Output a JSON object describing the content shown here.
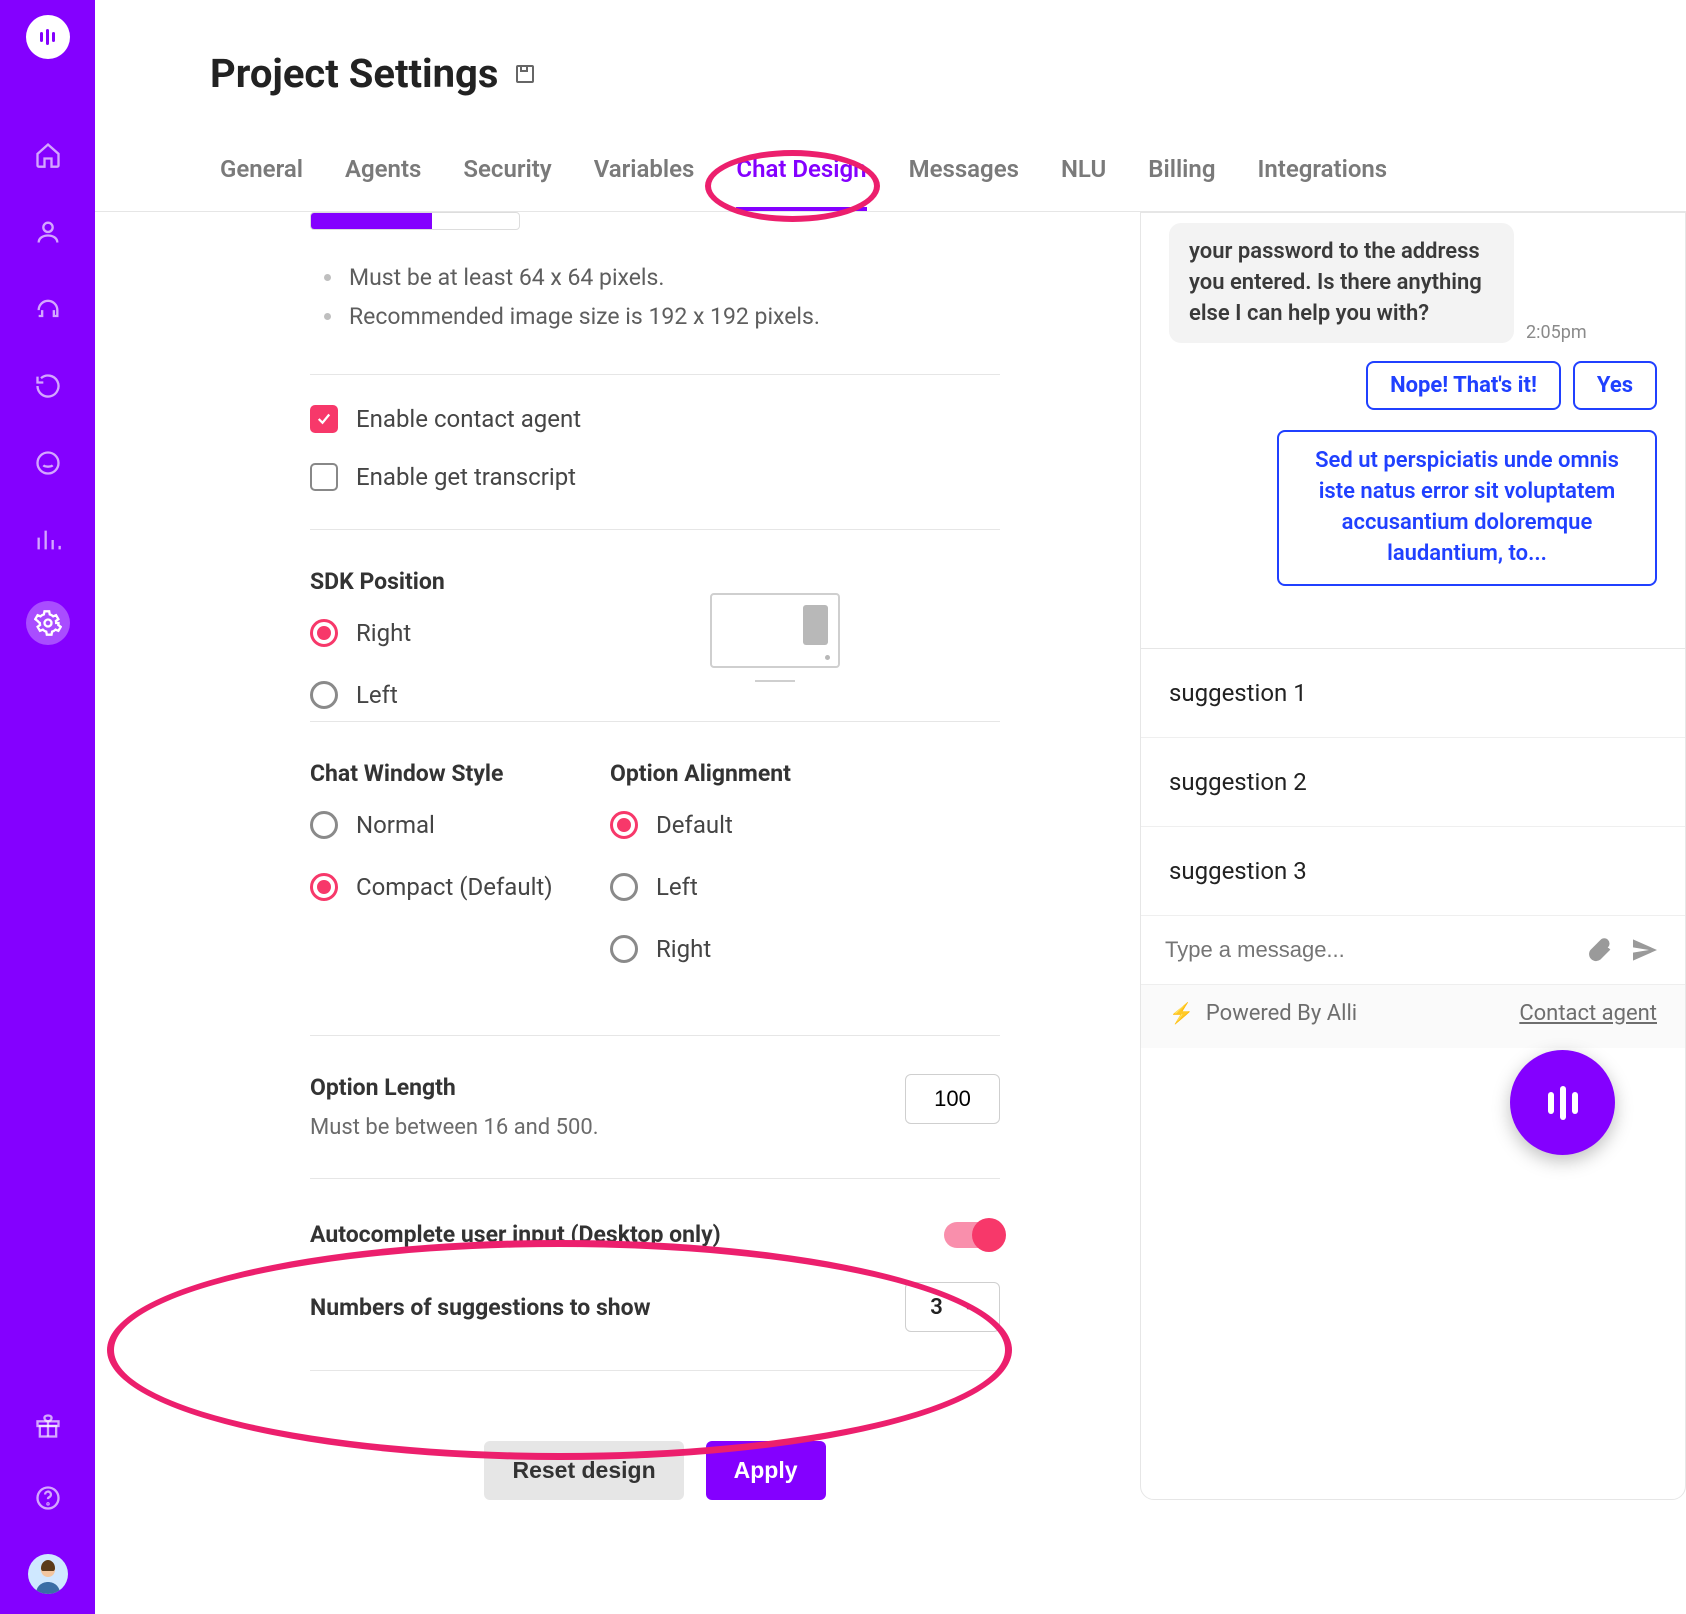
{
  "page": {
    "title": "Project Settings"
  },
  "tabs": {
    "general": "General",
    "agents": "Agents",
    "security": "Security",
    "variables": "Variables",
    "chat_design": "Chat Design",
    "messages": "Messages",
    "nlu": "NLU",
    "billing": "Billing",
    "integrations": "Integrations"
  },
  "image_req": {
    "line1": "Must be at least 64 x 64 pixels.",
    "line2": "Recommended image size is 192 x 192 pixels."
  },
  "checkboxes": {
    "contact_agent": "Enable contact agent",
    "get_transcript": "Enable get transcript"
  },
  "sdk_position": {
    "title": "SDK Position",
    "right": "Right",
    "left": "Left"
  },
  "chat_style": {
    "title": "Chat Window Style",
    "normal": "Normal",
    "compact": "Compact (Default)"
  },
  "option_align": {
    "title": "Option Alignment",
    "default": "Default",
    "left": "Left",
    "right": "Right"
  },
  "option_length": {
    "title": "Option Length",
    "hint": "Must be between 16 and 500.",
    "value": "100"
  },
  "autocomplete": {
    "title": "Autocomplete user input (Desktop only)",
    "suggestions_label": "Numbers of suggestions to show",
    "suggestions_value": "3"
  },
  "actions": {
    "reset": "Reset design",
    "apply": "Apply"
  },
  "chat": {
    "bot_line": "your password to the address you entered. Is there anything else I can help you with?",
    "time": "2:05pm",
    "chip_nope": "Nope! That's it!",
    "chip_yes": "Yes",
    "lorem": "Sed ut perspiciatis unde omnis iste natus error sit voluptatem accusantium doloremque laudantium, to...",
    "s1": "suggestion 1",
    "s2": "suggestion 2",
    "s3": "suggestion 3",
    "placeholder": "Type a message...",
    "powered": "Powered By Alli",
    "contact": "Contact agent"
  }
}
